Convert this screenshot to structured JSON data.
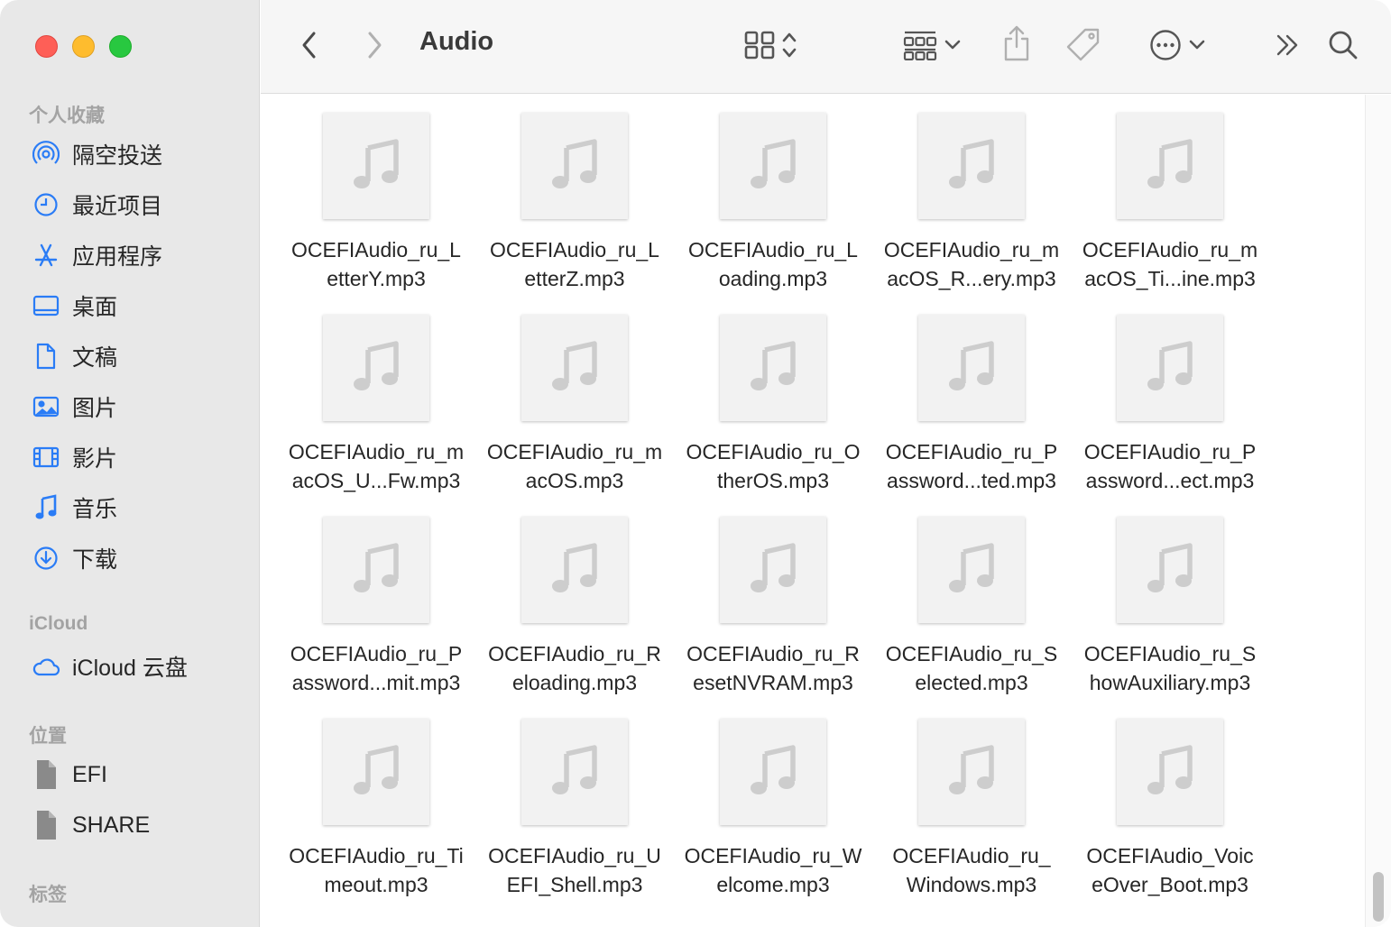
{
  "window": {
    "title": "Audio"
  },
  "sidebar": {
    "favorites_header": "个人收藏",
    "favorites": [
      {
        "label": "隔空投送",
        "icon": "airdrop-icon"
      },
      {
        "label": "最近项目",
        "icon": "clock-icon"
      },
      {
        "label": "应用程序",
        "icon": "applications-icon"
      },
      {
        "label": "桌面",
        "icon": "desktop-icon"
      },
      {
        "label": "文稿",
        "icon": "document-icon"
      },
      {
        "label": "图片",
        "icon": "picture-icon"
      },
      {
        "label": "影片",
        "icon": "film-icon"
      },
      {
        "label": "音乐",
        "icon": "music-note-icon"
      },
      {
        "label": "下载",
        "icon": "download-icon"
      }
    ],
    "icloud_header": "iCloud",
    "icloud": [
      {
        "label": "iCloud 云盘",
        "icon": "cloud-icon"
      }
    ],
    "locations_header": "位置",
    "locations": [
      {
        "label": "EFI",
        "icon": "drive-icon"
      },
      {
        "label": "SHARE",
        "icon": "drive-icon"
      }
    ],
    "tags_header": "标签"
  },
  "toolbar": {
    "back_icon": "chevron-left-icon",
    "forward_icon": "chevron-right-icon",
    "view_icon": "icon-view-grid-icon",
    "group_icon": "group-by-icon",
    "share_icon": "share-icon",
    "tag_icon": "tag-icon",
    "action_icon": "more-actions-icon",
    "overflow_icon": "double-chevron-right-icon",
    "search_icon": "search-icon"
  },
  "colors": {
    "accent": "#2a7cf6",
    "sidebar_bg": "#e8e8e8",
    "close": "#fe5f57",
    "minimize": "#febc2e",
    "zoom": "#28c840"
  },
  "files": [
    {
      "line1": "OCEFIAudio_ru_L",
      "line2": "etterY.mp3"
    },
    {
      "line1": "OCEFIAudio_ru_L",
      "line2": "etterZ.mp3"
    },
    {
      "line1": "OCEFIAudio_ru_L",
      "line2": "oading.mp3"
    },
    {
      "line1": "OCEFIAudio_ru_m",
      "line2": "acOS_R...ery.mp3"
    },
    {
      "line1": "OCEFIAudio_ru_m",
      "line2": "acOS_Ti...ine.mp3"
    },
    {
      "line1": "OCEFIAudio_ru_m",
      "line2": "acOS_U...Fw.mp3"
    },
    {
      "line1": "OCEFIAudio_ru_m",
      "line2": "acOS.mp3"
    },
    {
      "line1": "OCEFIAudio_ru_O",
      "line2": "therOS.mp3"
    },
    {
      "line1": "OCEFIAudio_ru_P",
      "line2": "assword...ted.mp3"
    },
    {
      "line1": "OCEFIAudio_ru_P",
      "line2": "assword...ect.mp3"
    },
    {
      "line1": "OCEFIAudio_ru_P",
      "line2": "assword...mit.mp3"
    },
    {
      "line1": "OCEFIAudio_ru_R",
      "line2": "eloading.mp3"
    },
    {
      "line1": "OCEFIAudio_ru_R",
      "line2": "esetNVRAM.mp3"
    },
    {
      "line1": "OCEFIAudio_ru_S",
      "line2": "elected.mp3"
    },
    {
      "line1": "OCEFIAudio_ru_S",
      "line2": "howAuxiliary.mp3"
    },
    {
      "line1": "OCEFIAudio_ru_Ti",
      "line2": "meout.mp3"
    },
    {
      "line1": "OCEFIAudio_ru_U",
      "line2": "EFI_Shell.mp3"
    },
    {
      "line1": "OCEFIAudio_ru_W",
      "line2": "elcome.mp3"
    },
    {
      "line1": "OCEFIAudio_ru_",
      "line2": "Windows.mp3"
    },
    {
      "line1": "OCEFIAudio_Voic",
      "line2": "eOver_Boot.mp3"
    }
  ]
}
